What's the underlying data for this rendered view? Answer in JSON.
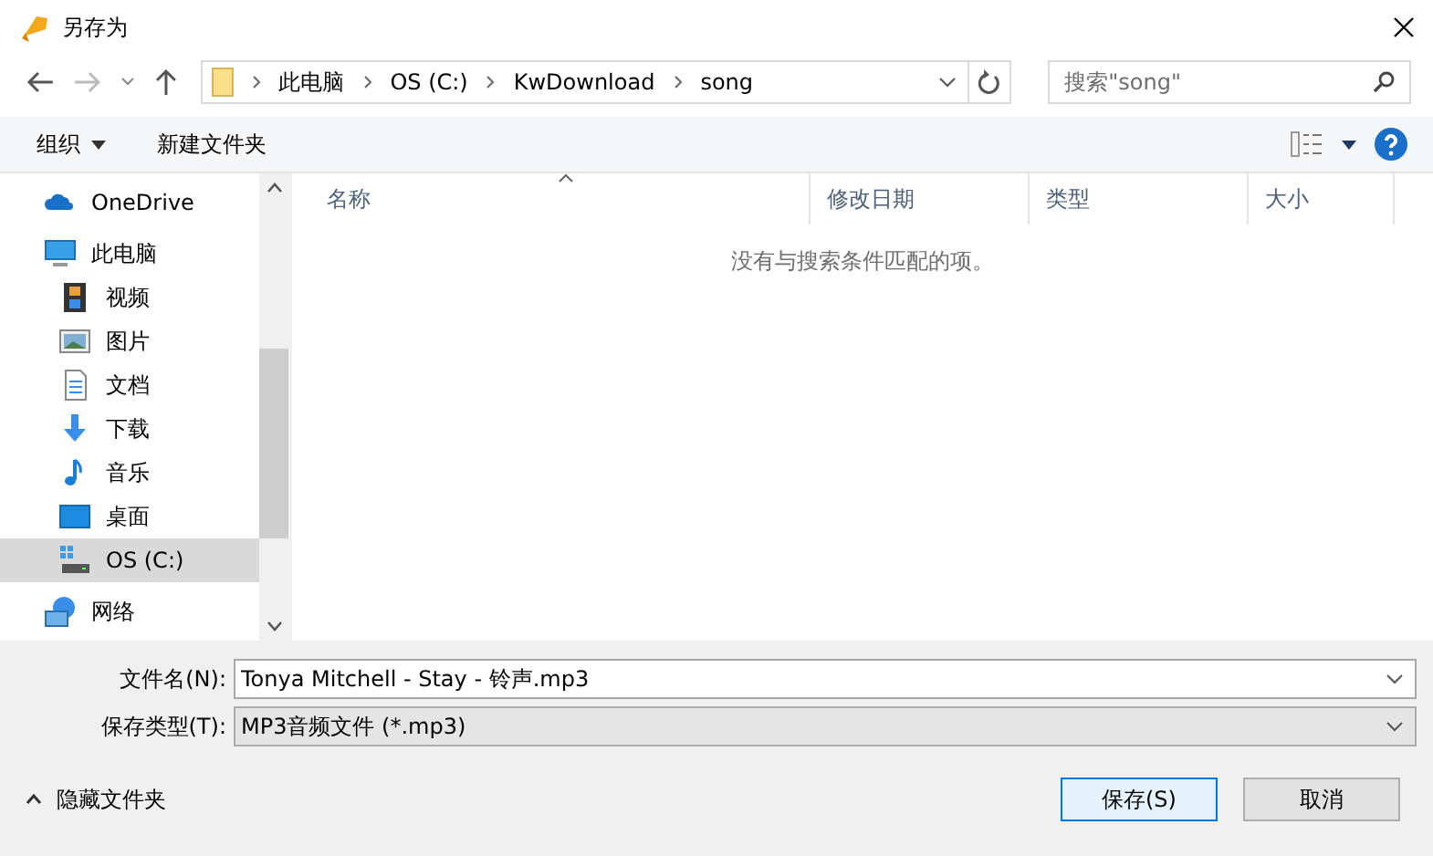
{
  "window": {
    "title": "另存为"
  },
  "address": {
    "crumbs": [
      "此电脑",
      "OS (C:)",
      "KwDownload",
      "song"
    ]
  },
  "search": {
    "placeholder": "搜索\"song\""
  },
  "toolbar": {
    "organize": "组织",
    "new_folder": "新建文件夹"
  },
  "sidebar": {
    "items": [
      {
        "label": "OneDrive",
        "kind": "cloud",
        "selected": false
      },
      {
        "label": "此电脑",
        "kind": "pc",
        "selected": false,
        "children": [
          {
            "label": "视频",
            "kind": "video",
            "selected": false
          },
          {
            "label": "图片",
            "kind": "image",
            "selected": false
          },
          {
            "label": "文档",
            "kind": "doc",
            "selected": false
          },
          {
            "label": "下载",
            "kind": "download",
            "selected": false
          },
          {
            "label": "音乐",
            "kind": "music",
            "selected": false
          },
          {
            "label": "桌面",
            "kind": "desktop",
            "selected": false
          },
          {
            "label": "OS (C:)",
            "kind": "drive",
            "selected": true
          }
        ]
      },
      {
        "label": "网络",
        "kind": "network",
        "selected": false
      }
    ]
  },
  "table": {
    "columns": [
      "名称",
      "修改日期",
      "类型",
      "大小"
    ],
    "empty_message": "没有与搜索条件匹配的项。"
  },
  "form": {
    "filename_label": "文件名(N):",
    "filename": "Tonya Mitchell - Stay - 铃声.mp3",
    "type_label": "保存类型(T):",
    "type": "MP3音频文件 (*.mp3)"
  },
  "hide_folders": "隐藏文件夹",
  "buttons": [
    {
      "label": "保存(S)",
      "kind": "primary"
    },
    {
      "label": "取消",
      "kind": "normal"
    }
  ]
}
